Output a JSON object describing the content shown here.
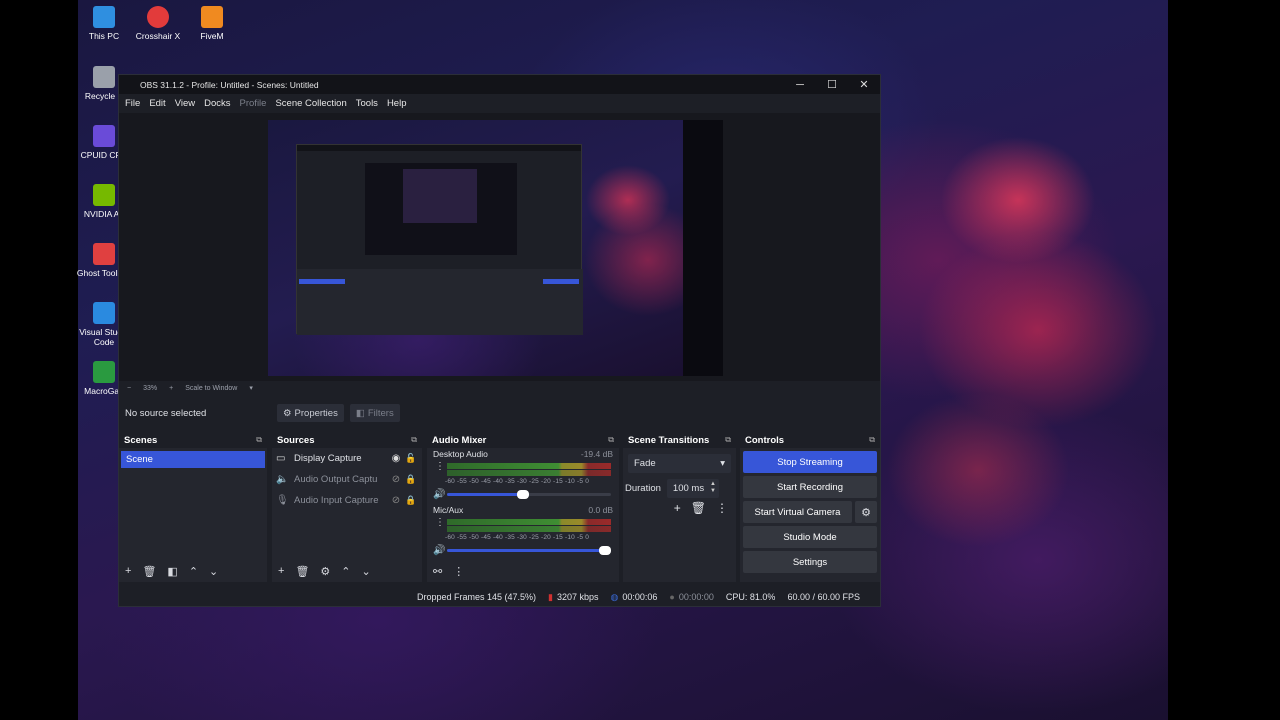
{
  "desktop": {
    "icons": [
      {
        "label": "This PC",
        "icon": "monitor-icon",
        "color": "#2f8fe0"
      },
      {
        "label": "Crosshair X",
        "icon": "crosshair-icon",
        "color": "#e23b3b"
      },
      {
        "label": "FiveM",
        "icon": "fivem-icon",
        "color": "#f08a20"
      },
      {
        "label": "Recycle B",
        "icon": "recycle-bin-icon",
        "color": "#9aa0aa"
      },
      {
        "label": "CPUID CPU",
        "icon": "cpuid-icon",
        "color": "#6a4bd8"
      },
      {
        "label": "NVIDIA Ap",
        "icon": "nvidia-icon",
        "color": "#76b900"
      },
      {
        "label": "Ghost Toolbox",
        "icon": "ghost-icon",
        "color": "#e04040"
      },
      {
        "label": "Visual Studio Code",
        "icon": "vscode-icon",
        "color": "#2a8ae0"
      },
      {
        "label": "MacroGan",
        "icon": "macro-icon",
        "color": "#2a9a40"
      }
    ]
  },
  "window": {
    "title": "OBS 31.1.2 - Profile: Untitled - Scenes: Untitled",
    "controls": {
      "minimize": "─",
      "maximize": "☐",
      "close": "✕"
    }
  },
  "menu": [
    "File",
    "Edit",
    "View",
    "Docks",
    "Profile",
    "Scene Collection",
    "Tools",
    "Help"
  ],
  "zoom": {
    "minus": "−",
    "value": "33%",
    "plus": "+",
    "mode": "Scale to Window"
  },
  "source_bar": {
    "status": "No source selected",
    "properties": "Properties",
    "filters": "Filters"
  },
  "scenes": {
    "title": "Scenes",
    "items": [
      "Scene"
    ]
  },
  "sources": {
    "title": "Sources",
    "items": [
      {
        "name": "Display Capture",
        "icon": "monitor-icon"
      },
      {
        "name": "Audio Output Captu",
        "icon": "speaker-icon"
      },
      {
        "name": "Audio Input Capture",
        "icon": "microphone-icon"
      }
    ]
  },
  "mixer": {
    "title": "Audio Mixer",
    "channels": [
      {
        "name": "Desktop Audio",
        "db": "-19.4 dB",
        "level": 0.5
      },
      {
        "name": "Mic/Aux",
        "db": "0.0 dB",
        "level": 1.0
      }
    ],
    "ticks": "-60 -55 -50 -45 -40 -35 -30 -25 -20 -15 -10 -5 0"
  },
  "transitions": {
    "title": "Scene Transitions",
    "selected": "Fade",
    "duration_label": "Duration",
    "duration_value": "100 ms"
  },
  "controls": {
    "title": "Controls",
    "stop_streaming": "Stop Streaming",
    "start_recording": "Start Recording",
    "start_virtual_camera": "Start Virtual Camera",
    "studio_mode": "Studio Mode",
    "settings": "Settings"
  },
  "status": {
    "dropped_frames": "Dropped Frames 145 (47.5%)",
    "bitrate": "3207 kbps",
    "stream_time": "00:00:06",
    "record_time": "00:00:00",
    "cpu": "CPU: 81.0%",
    "fps": "60.00 / 60.00 FPS"
  },
  "colors": {
    "accent": "#3756d8",
    "window_bg": "#1d1f26",
    "dock_bg": "#24262e"
  }
}
